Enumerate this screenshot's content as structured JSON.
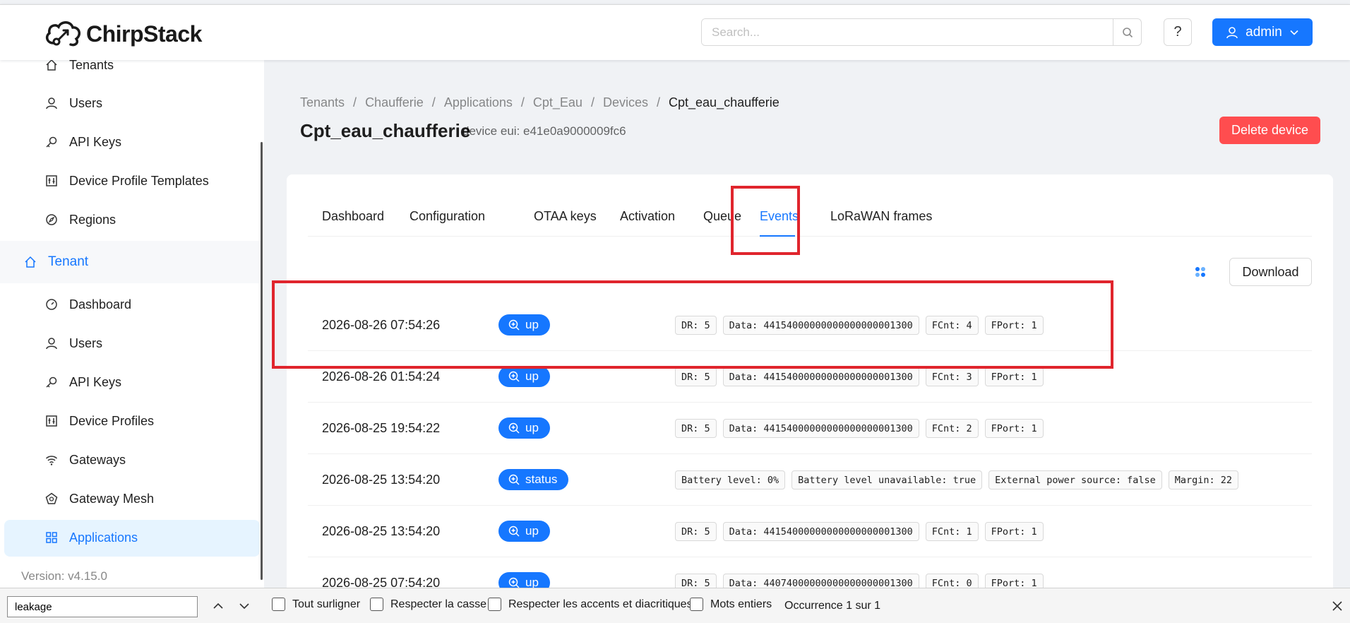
{
  "header": {
    "app_name": "ChirpStack",
    "search_placeholder": "Search...",
    "help_label": "?",
    "user_label": "admin"
  },
  "sidebar": {
    "items": [
      {
        "label": "Tenants",
        "icon": "home-icon"
      },
      {
        "label": "Users",
        "icon": "user-icon"
      },
      {
        "label": "API Keys",
        "icon": "key-icon"
      },
      {
        "label": "Device Profile Templates",
        "icon": "control-icon"
      },
      {
        "label": "Regions",
        "icon": "compass-icon"
      }
    ],
    "group_label": "Tenant",
    "tenant_items": [
      {
        "label": "Dashboard",
        "icon": "dashboard-icon"
      },
      {
        "label": "Users",
        "icon": "user-icon"
      },
      {
        "label": "API Keys",
        "icon": "key-icon"
      },
      {
        "label": "Device Profiles",
        "icon": "control-icon"
      },
      {
        "label": "Gateways",
        "icon": "wifi-icon"
      },
      {
        "label": "Gateway Mesh",
        "icon": "radar-icon"
      },
      {
        "label": "Applications",
        "icon": "appstore-icon",
        "active": true
      }
    ],
    "version": "Version: v4.15.0"
  },
  "breadcrumb": [
    "Tenants",
    "Chaufferie",
    "Applications",
    "Cpt_Eau",
    "Devices",
    "Cpt_eau_chaufferie"
  ],
  "breadcrumb_sep": "/",
  "page": {
    "title": "Cpt_eau_chaufferie",
    "subtitle": "device eui: e41e0a9000009fc6",
    "delete_label": "Delete device"
  },
  "tabs": [
    "Dashboard",
    "Configuration",
    "OTAA keys",
    "Activation",
    "Queue",
    "Events",
    "LoRaWAN frames"
  ],
  "active_tab": "Events",
  "download_label": "Download",
  "events": [
    {
      "time": "2026-08-26 07:54:26",
      "type": "up",
      "chips": [
        "DR: 5",
        "Data: 44154000000000000000001300",
        "FCnt: 4",
        "FPort: 1"
      ]
    },
    {
      "time": "2026-08-26 01:54:24",
      "type": "up",
      "chips": [
        "DR: 5",
        "Data: 44154000000000000000001300",
        "FCnt: 3",
        "FPort: 1"
      ]
    },
    {
      "time": "2026-08-25 19:54:22",
      "type": "up",
      "chips": [
        "DR: 5",
        "Data: 44154000000000000000001300",
        "FCnt: 2",
        "FPort: 1"
      ]
    },
    {
      "time": "2026-08-25 13:54:20",
      "type": "status",
      "chips": [
        "Battery level: 0%",
        "Battery level unavailable: true",
        "External power source: false",
        "Margin: 22"
      ]
    },
    {
      "time": "2026-08-25 13:54:20",
      "type": "up",
      "chips": [
        "DR: 5",
        "Data: 44154000000000000000001300",
        "FCnt: 1",
        "FPort: 1"
      ]
    },
    {
      "time": "2026-08-25 07:54:20",
      "type": "up",
      "chips": [
        "DR: 5",
        "Data: 44074000000000000000001300",
        "FCnt: 0",
        "FPort: 1"
      ]
    }
  ],
  "findbar": {
    "query": "leakage",
    "options": [
      "Tout surligner",
      "Respecter la casse",
      "Respecter les accents et diacritiques",
      "Mots entiers"
    ],
    "status": "Occurrence 1 sur 1"
  },
  "colors": {
    "accent": "#1677ff",
    "danger": "#ff4d4f",
    "highlight": "#e0252d"
  }
}
